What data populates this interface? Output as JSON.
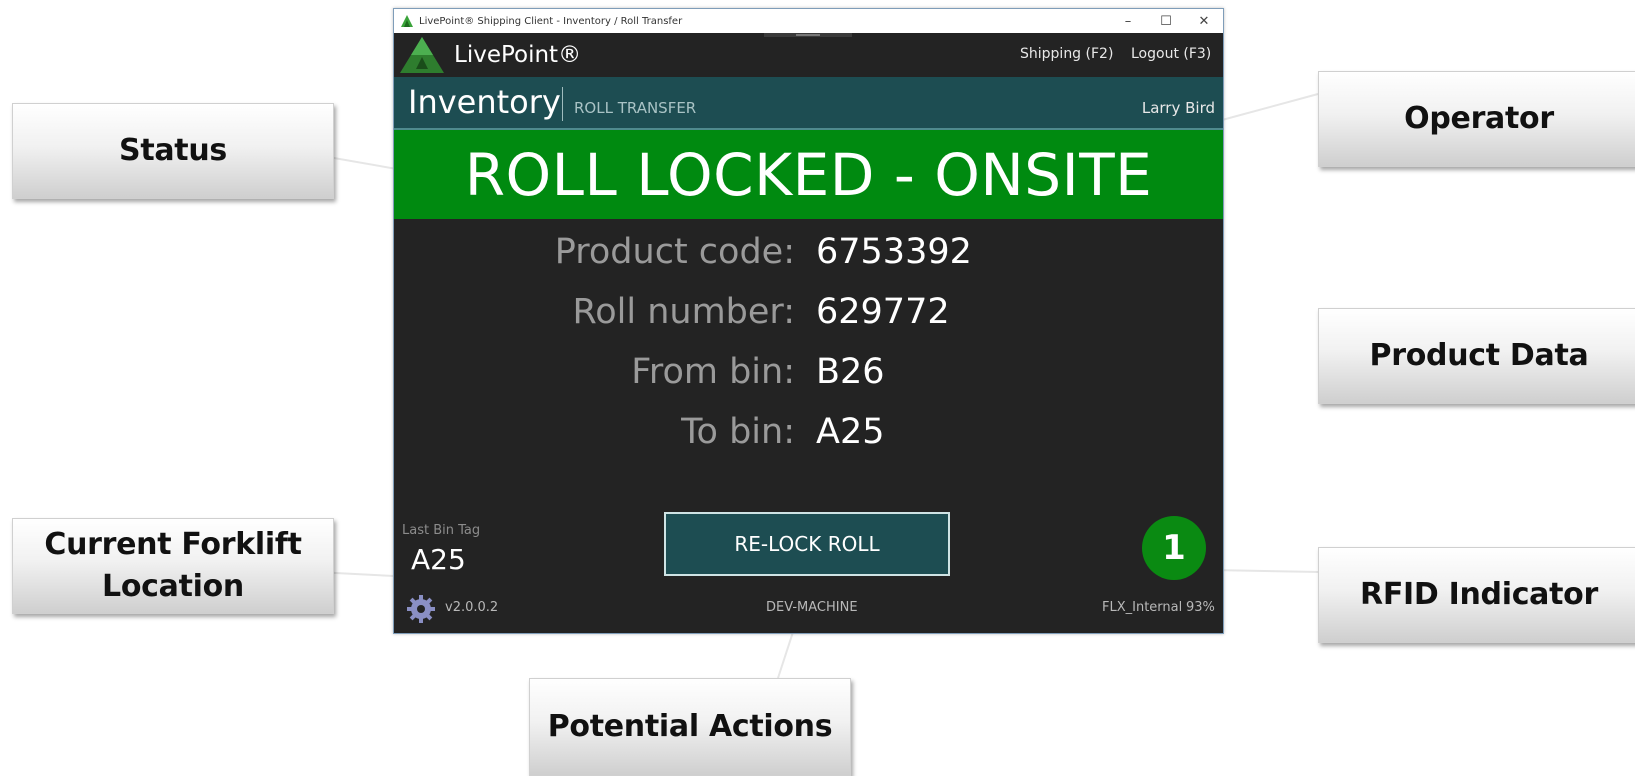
{
  "window": {
    "title": "LivePoint® Shipping Client - Inventory / Roll Transfer",
    "controls": {
      "minimize": "–",
      "maximize": "☐",
      "close": "✕"
    }
  },
  "appbar": {
    "brand": "LivePoint®",
    "menu": [
      {
        "label": "Shipping (F2)"
      },
      {
        "label": "Logout (F3)"
      }
    ]
  },
  "module": {
    "title": "Inventory",
    "subtitle": "ROLL TRANSFER",
    "operator": "Larry Bird"
  },
  "status": "ROLL LOCKED - ONSITE",
  "fields": [
    {
      "label": "Product code:",
      "value": "6753392"
    },
    {
      "label": "Roll number:",
      "value": "629772"
    },
    {
      "label": "From bin:",
      "value": "B26"
    },
    {
      "label": "To bin:",
      "value": "A25"
    }
  ],
  "last_bin": {
    "label": "Last Bin Tag",
    "value": "A25"
  },
  "actions": {
    "relock_label": "RE-LOCK ROLL"
  },
  "rfid": {
    "count": "1"
  },
  "footer": {
    "version": "v2.0.0.2",
    "machine": "DEV-MACHINE",
    "network": "FLX_Internal",
    "battery": "93%"
  },
  "callouts": {
    "status": "Status",
    "operator": "Operator",
    "product_data": "Product Data",
    "forklift_line1": "Current Forklift",
    "forklift_line2": "Location",
    "rfid": "RFID Indicator",
    "actions": "Potential Actions"
  },
  "colors": {
    "status_green": "#008a10",
    "module_teal": "#1d4d52",
    "app_dark": "#232323"
  }
}
